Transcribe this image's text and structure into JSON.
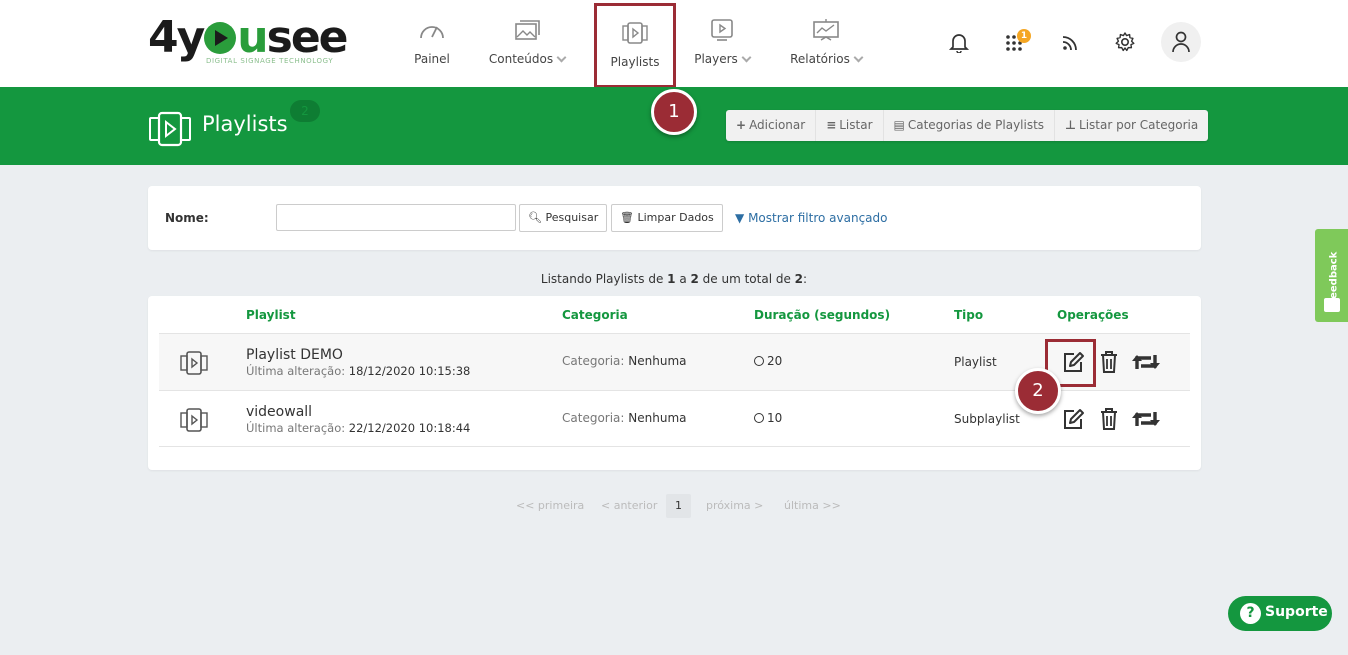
{
  "brand": {
    "logo_parts": [
      "4y",
      "u",
      "see"
    ],
    "tagline": "DIGITAL SIGNAGE TECHNOLOGY"
  },
  "nav": {
    "items": [
      {
        "label": "Painel",
        "icon": "gauge-icon"
      },
      {
        "label": "Conteúdos",
        "icon": "images-icon"
      },
      {
        "label": "Playlists",
        "icon": "playlist-icon"
      },
      {
        "label": "Players",
        "icon": "player-icon"
      },
      {
        "label": "Relatórios",
        "icon": "chart-icon"
      }
    ],
    "notifications_badge": "1"
  },
  "header": {
    "title": "Playlists",
    "count_badge": "2",
    "actions": [
      {
        "icon": "+",
        "label": "Adicionar"
      },
      {
        "icon": "≡",
        "label": "Listar"
      },
      {
        "icon": "▤",
        "label": "Categorias de Playlists"
      },
      {
        "icon": "⊥",
        "label": "Listar por Categoria"
      }
    ]
  },
  "markers": [
    "1",
    "2"
  ],
  "filter": {
    "name_label": "Nome:",
    "name_value": "",
    "search_label": "Pesquisar",
    "clear_label": "Limpar Dados",
    "advanced_label": "Mostrar filtro avançado"
  },
  "listing": {
    "prefix": "Listando Playlists de ",
    "from": "1",
    "sep1": " a ",
    "to": "2",
    "sep2": " de um total de ",
    "total": "2",
    "suffix": ":"
  },
  "table": {
    "columns": [
      "Playlist",
      "Categoria",
      "Duração (segundos)",
      "Tipo",
      "Operações"
    ],
    "rows": [
      {
        "name": "Playlist DEMO",
        "last_change_label": "Última alteração: ",
        "last_change": "18/12/2020 10:15:38",
        "category_label": "Categoria: ",
        "category": "Nenhuma",
        "duration": "20",
        "type": "Playlist"
      },
      {
        "name": "videowall",
        "last_change_label": "Última alteração: ",
        "last_change": "22/12/2020 10:18:44",
        "category_label": "Categoria: ",
        "category": "Nenhuma",
        "duration": "10",
        "type": "Subplaylist"
      }
    ]
  },
  "pagination": {
    "first": "<< primeira",
    "prev": "< anterior",
    "current": "1",
    "next": "próxima >",
    "last": "última >>"
  },
  "feedback_label": "Feedback",
  "support_label": "Suporte",
  "colors": {
    "brand_green": "#14973f",
    "highlight_red": "#9b2c35",
    "link_blue": "#2d6ea3",
    "badge_orange": "#f5a623"
  }
}
